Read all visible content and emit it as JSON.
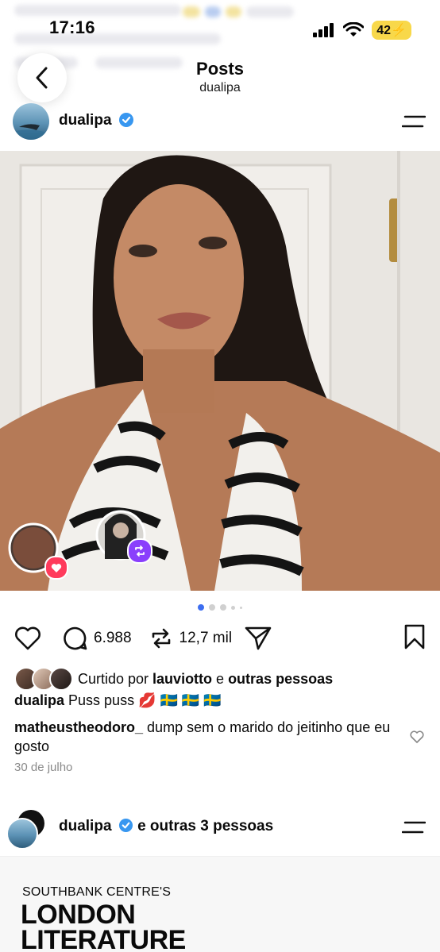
{
  "status_bar": {
    "time": "17:16",
    "battery": "42"
  },
  "header": {
    "title": "Posts",
    "subtitle": "dualipa"
  },
  "post1": {
    "username": "dualipa",
    "stats": {
      "comments": "6.988",
      "reposts": "12,7 mil"
    },
    "liked_prefix": "Curtido por",
    "liked_user": "lauviotto",
    "liked_joiner": "e",
    "liked_rest": "outras pessoas",
    "caption_user": "dualipa",
    "caption_text": "Puss puss",
    "caption_emoji": "💋 🇸🇪 🇸🇪 🇸🇪",
    "comment_user": "matheustheodoro_",
    "comment_text": "dump sem o marido do jeitinho que eu gosto",
    "date": "30 de julho",
    "carousel_index": 1
  },
  "post2": {
    "username": "dualipa",
    "others": "e outras 3 pessoas",
    "image_line1": "SOUTHBANK CENTRE'S",
    "image_line2": "LONDON",
    "image_line3": "LITERATURE"
  },
  "colors": {
    "verified": "#3897f0",
    "repost_badge": "#8a3ffc",
    "heart_badge": "#ff3b5c",
    "carousel_active": "#3d6ef0"
  },
  "icons": [
    "back-icon",
    "verified-icon",
    "menu-icon",
    "heart-icon",
    "comment-icon",
    "repost-icon",
    "share-icon",
    "bookmark-icon",
    "small-heart-icon",
    "signal-icon",
    "wifi-icon"
  ]
}
